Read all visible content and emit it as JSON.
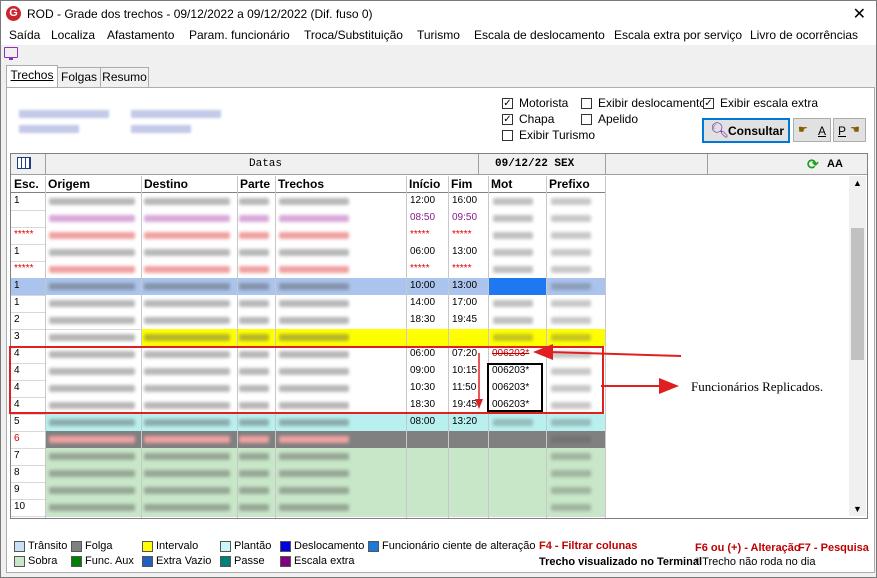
{
  "window": {
    "title": "ROD - Grade dos trechos - 09/12/2022 a 09/12/2022 (Dif. fuso 0)",
    "icon_letter": "G",
    "close": "✕"
  },
  "menu": [
    "Saída",
    "Localiza",
    "Afastamento",
    "Param. funcionário",
    "Troca/Substituição",
    "Turismo",
    "Escala de deslocamento",
    "Escala extra por serviço",
    "Livro de ocorrências"
  ],
  "tabs": [
    "Trechos",
    "Folgas",
    "Resumo"
  ],
  "filters": {
    "motorista": {
      "label": "Motorista",
      "checked": true
    },
    "chapa": {
      "label": "Chapa",
      "checked": true
    },
    "exibir_turismo": {
      "label": "Exibir Turismo",
      "checked": false
    },
    "exibir_deslocamento": {
      "label": "Exibir deslocamento",
      "checked": false
    },
    "apelido": {
      "label": "Apelido",
      "checked": false
    },
    "exibir_escala_extra": {
      "label": "Exibir escala extra",
      "checked": true
    }
  },
  "buttons": {
    "consultar": "Consultar",
    "ordem_a": "A",
    "ordem_p": "P"
  },
  "grid": {
    "datas_label": "Datas",
    "date_label": "09/12/22 SEX",
    "font_label": "AA",
    "columns": [
      "Esc.",
      "Origem",
      "Destino",
      "Parte",
      "Trechos",
      "Início",
      "Fim",
      "Mot",
      "Prefixo"
    ],
    "rows": [
      {
        "esc": "1",
        "inicio": "12:00",
        "fim": "16:00",
        "mot": "",
        "bg": "#ffffff",
        "fg": "#000000"
      },
      {
        "esc": "",
        "inicio": "08:50",
        "fim": "09:50",
        "mot": "",
        "bg": "#ffffff",
        "fg": "#8b1a8b"
      },
      {
        "esc": "*****",
        "inicio": "*****",
        "fim": "*****",
        "mot": "",
        "bg": "#ffffff",
        "fg": "#e00000"
      },
      {
        "esc": "1",
        "inicio": "06:00",
        "fim": "13:00",
        "mot": "",
        "bg": "#ffffff",
        "fg": "#000000"
      },
      {
        "esc": "*****",
        "inicio": "*****",
        "fim": "*****",
        "mot": "",
        "bg": "#ffffff",
        "fg": "#e00000"
      },
      {
        "esc": "1",
        "inicio": "10:00",
        "fim": "13:00",
        "mot": "",
        "bg": "#aac4ee",
        "fg": "#000000"
      },
      {
        "esc": "1",
        "inicio": "14:00",
        "fim": "17:00",
        "mot": "",
        "bg": "#ffffff",
        "fg": "#000000"
      },
      {
        "esc": "2",
        "inicio": "18:30",
        "fim": "19:45",
        "mot": "",
        "bg": "#ffffff",
        "fg": "#000000"
      },
      {
        "esc": "3",
        "inicio": "",
        "fim": "",
        "mot": "",
        "bg": "#ffff00",
        "fg": "#000000"
      },
      {
        "esc": "4",
        "inicio": "06:00",
        "fim": "07:20",
        "mot": "006203*",
        "bg": "#ffffff",
        "fg": "#000000"
      },
      {
        "esc": "4",
        "inicio": "09:00",
        "fim": "10:15",
        "mot": "006203*",
        "bg": "#ffffff",
        "fg": "#000000"
      },
      {
        "esc": "4",
        "inicio": "10:30",
        "fim": "11:50",
        "mot": "006203*",
        "bg": "#ffffff",
        "fg": "#000000"
      },
      {
        "esc": "4",
        "inicio": "18:30",
        "fim": "19:45",
        "mot": "006203*",
        "bg": "#ffffff",
        "fg": "#000000"
      },
      {
        "esc": "5",
        "inicio": "08:00",
        "fim": "13:20",
        "mot": "",
        "bg": "#b8f0f0",
        "fg": "#000000"
      },
      {
        "esc": "6",
        "inicio": "",
        "fim": "",
        "mot": "",
        "bg": "#808080",
        "fg": "#e00000"
      },
      {
        "esc": "7",
        "inicio": "",
        "fim": "",
        "mot": "",
        "bg": "#c8e6c8",
        "fg": "#000000"
      },
      {
        "esc": "8",
        "inicio": "",
        "fim": "",
        "mot": "",
        "bg": "#c8e6c8",
        "fg": "#000000"
      },
      {
        "esc": "9",
        "inicio": "",
        "fim": "",
        "mot": "",
        "bg": "#c8e6c8",
        "fg": "#000000"
      },
      {
        "esc": "10",
        "inicio": "",
        "fim": "",
        "mot": "",
        "bg": "#c8e6c8",
        "fg": "#000000"
      }
    ]
  },
  "annotation": "Funcionários Replicados.",
  "legend": [
    {
      "label": "Trânsito",
      "color": "#c8e0f8"
    },
    {
      "label": "Folga",
      "color": "#808080"
    },
    {
      "label": "Intervalo",
      "color": "#ffff00"
    },
    {
      "label": "Plantão",
      "color": "#c8f8f8"
    },
    {
      "label": "Deslocamento",
      "color": "#0000e0"
    },
    {
      "label": "Funcionário ciente de alteração",
      "color": "#1e78d8"
    },
    {
      "label": "Sobra",
      "color": "#c8e6c8"
    },
    {
      "label": "Func. Aux",
      "color": "#008000"
    },
    {
      "label": "Extra Vazio",
      "color": "#2060c0"
    },
    {
      "label": "Passe",
      "color": "#00807a"
    },
    {
      "label": "Escala extra",
      "color": "#800080"
    }
  ],
  "hints": {
    "f4": "F4 - Filtrar colunas",
    "f6": "F6 ou (+) - Alteração",
    "f7": "F7 - Pesquisa",
    "terminal": "Trecho visualizado no Terminal",
    "nao_roda": "* Trecho não roda no dia"
  }
}
